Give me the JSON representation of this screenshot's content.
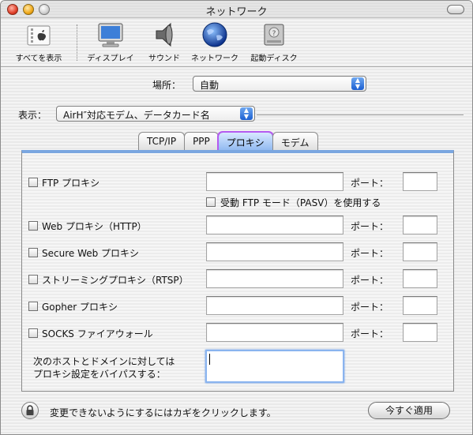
{
  "window": {
    "title": "ネットワーク"
  },
  "toolbar": {
    "items": [
      {
        "label": "すべてを表示",
        "icon": "apple-logo-icon"
      },
      {
        "label": "ディスプレイ",
        "icon": "display-icon"
      },
      {
        "label": "サウンド",
        "icon": "speaker-icon"
      },
      {
        "label": "ネットワーク",
        "icon": "globe-icon"
      },
      {
        "label": "起動ディスク",
        "icon": "hard-disk-icon"
      }
    ]
  },
  "location": {
    "label": "場所：",
    "value": "自動"
  },
  "show": {
    "label": "表示：",
    "value": "AirH″対応モデム、データカード名"
  },
  "tabs": [
    {
      "label": "TCP/IP",
      "active": false
    },
    {
      "label": "PPP",
      "active": false
    },
    {
      "label": "プロキシ",
      "active": true
    },
    {
      "label": "モデム",
      "active": false
    }
  ],
  "proxy": {
    "port_label": "ポート：",
    "items": [
      {
        "label": "FTP プロキシ",
        "checked": false,
        "server": "",
        "port": ""
      },
      {
        "label": "Web プロキシ（HTTP）",
        "checked": false,
        "server": "",
        "port": ""
      },
      {
        "label": "Secure Web プロキシ",
        "checked": false,
        "server": "",
        "port": ""
      },
      {
        "label": "ストリーミングプロキシ（RTSP）",
        "checked": false,
        "server": "",
        "port": ""
      },
      {
        "label": "Gopher プロキシ",
        "checked": false,
        "server": "",
        "port": ""
      },
      {
        "label": "SOCKS ファイアウォール",
        "checked": false,
        "server": "",
        "port": ""
      }
    ],
    "passive_mode": {
      "label": "受動 FTP モード（PASV）を使用する",
      "checked": false
    },
    "bypass": {
      "label_line1": "次のホストとドメインに対しては",
      "label_line2": "プロキシ設定をバイパスする：",
      "value": ""
    }
  },
  "footer": {
    "lock_text": "変更できないようにするにはカギをクリックします。",
    "apply_label": "今すぐ適用"
  },
  "colors": {
    "accent": "#1b5fd1",
    "tab_highlight": "#b45af0",
    "panel_top": "#7aa6e0"
  }
}
